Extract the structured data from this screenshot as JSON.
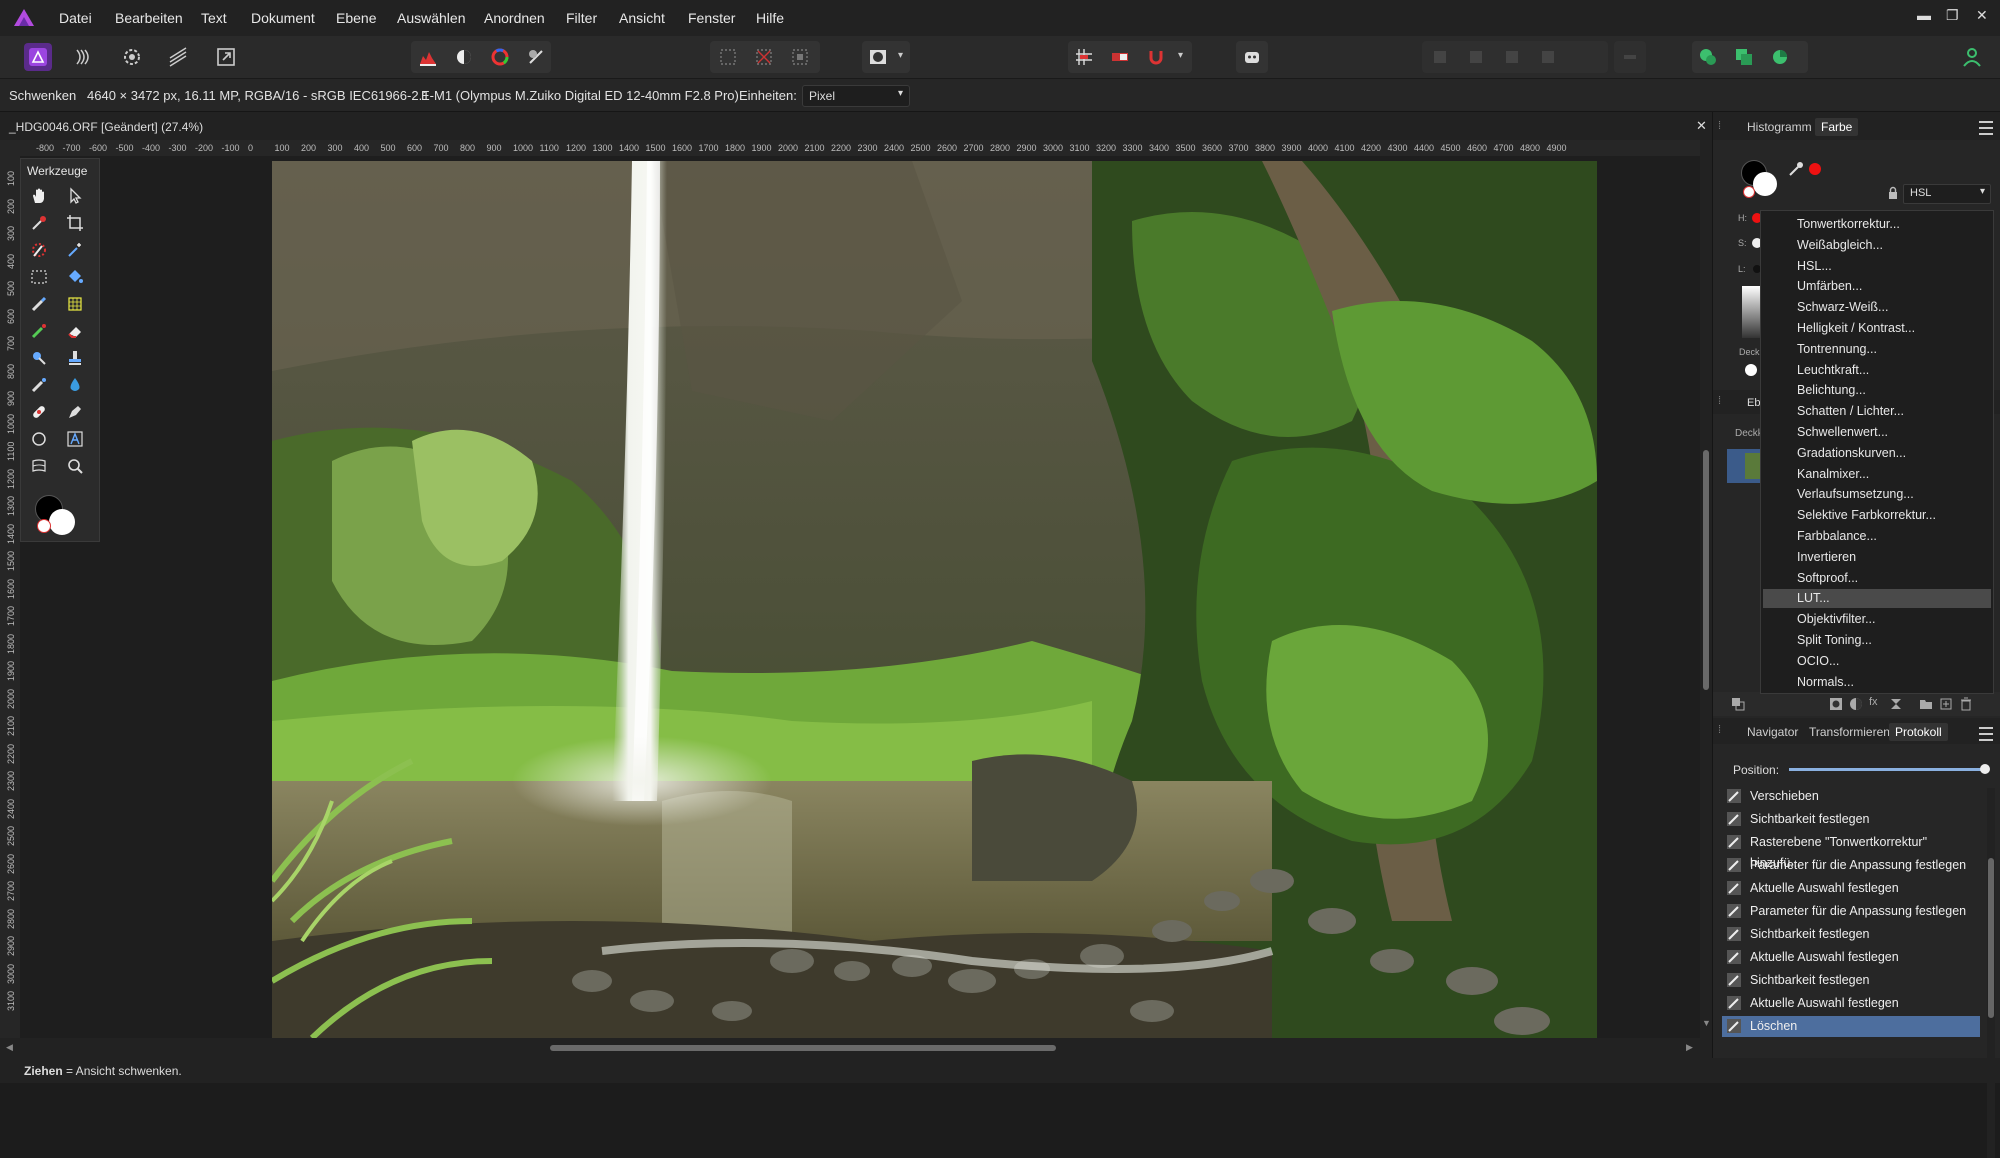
{
  "menu": {
    "items": [
      "Datei",
      "Bearbeiten",
      "Text",
      "Dokument",
      "Ebene",
      "Auswählen",
      "Anordnen",
      "Filter",
      "Ansicht",
      "Fenster",
      "Hilfe"
    ]
  },
  "contextbar": {
    "tool": "Schwenken",
    "info": "4640 × 3472 px, 16.11 MP, RGBA/16 - sRGB IEC61966-2.1",
    "camera": "E-M1 (Olympus M.Zuiko Digital ED 12-40mm F2.8 Pro)",
    "units_label": "Einheiten:",
    "units_value": "Pixel"
  },
  "document": {
    "tab_title": "_HDG0046.ORF [Geändert] (27.4%)",
    "close": "✕"
  },
  "ruler": {
    "h": [
      "-800",
      "-700",
      "-600",
      "-500",
      "-400",
      "-300",
      "-200",
      "-100",
      "0",
      "100",
      "200",
      "300",
      "400",
      "500",
      "600",
      "700",
      "800",
      "900",
      "1000",
      "1100",
      "1200",
      "1300",
      "1400",
      "1500",
      "1600",
      "1700",
      "1800",
      "1900",
      "2000",
      "2100",
      "2200",
      "2300",
      "2400",
      "2500",
      "2600",
      "2700",
      "2800",
      "2900",
      "3000",
      "3100",
      "3200",
      "3300",
      "3400",
      "3500",
      "3600",
      "3700",
      "3800",
      "3900",
      "4000",
      "4100",
      "4200",
      "4300",
      "4400",
      "4500",
      "4600",
      "4700",
      "4800",
      "4900"
    ],
    "v": [
      "100",
      "200",
      "300",
      "400",
      "500",
      "600",
      "700",
      "800",
      "900",
      "1000",
      "1100",
      "1200",
      "1300",
      "1400",
      "1500",
      "1600",
      "1700",
      "1800",
      "1900",
      "2000",
      "2100",
      "2200",
      "2300",
      "2400",
      "2500",
      "2600",
      "2700",
      "2800",
      "2900",
      "3000",
      "3100"
    ]
  },
  "tools_panel": {
    "title": "Werkzeuge"
  },
  "right_panel": {
    "top_tabs": [
      "Histogramm",
      "Farbe"
    ],
    "color_mode": "HSL",
    "labels": {
      "h": "H:",
      "s": "S:",
      "l": "L:",
      "deck": "Deck",
      "ebenen": "Eb",
      "deckkraft": "Deckk"
    },
    "bottom_tabs": [
      "Navigator",
      "Transformieren",
      "Protokoll"
    ],
    "position_label": "Position:"
  },
  "adjust_menu": {
    "items": [
      "Tonwertkorrektur...",
      "Weißabgleich...",
      "HSL...",
      "Umfärben...",
      "Schwarz-Weiß...",
      "Helligkeit / Kontrast...",
      "Tontrennung...",
      "Leuchtkraft...",
      "Belichtung...",
      "Schatten / Lichter...",
      "Schwellenwert...",
      "Gradationskurven...",
      "Kanalmixer...",
      "Verlaufsumsetzung...",
      "Selektive Farbkorrektur...",
      "Farbbalance...",
      "Invertieren",
      "Softproof...",
      "LUT...",
      "Objektivfilter...",
      "Split Toning...",
      "OCIO...",
      "Normals..."
    ],
    "selected_index": 18
  },
  "history": {
    "items": [
      "Verschieben",
      "Sichtbarkeit festlegen",
      "Rasterebene \"Tonwertkorrektur\" hinzufü...",
      "Parameter für die Anpassung festlegen",
      "Aktuelle Auswahl festlegen",
      "Parameter für die Anpassung festlegen",
      "Sichtbarkeit festlegen",
      "Aktuelle Auswahl festlegen",
      "Sichtbarkeit festlegen",
      "Aktuelle Auswahl festlegen",
      "Löschen"
    ],
    "selected_index": 10
  },
  "status": {
    "bold": "Ziehen",
    "rest": " = Ansicht schwenken."
  },
  "colors": {
    "accent": "#4d6e9e",
    "affinity_purple": "#8a3bd6",
    "green": "#3cbf6e"
  }
}
